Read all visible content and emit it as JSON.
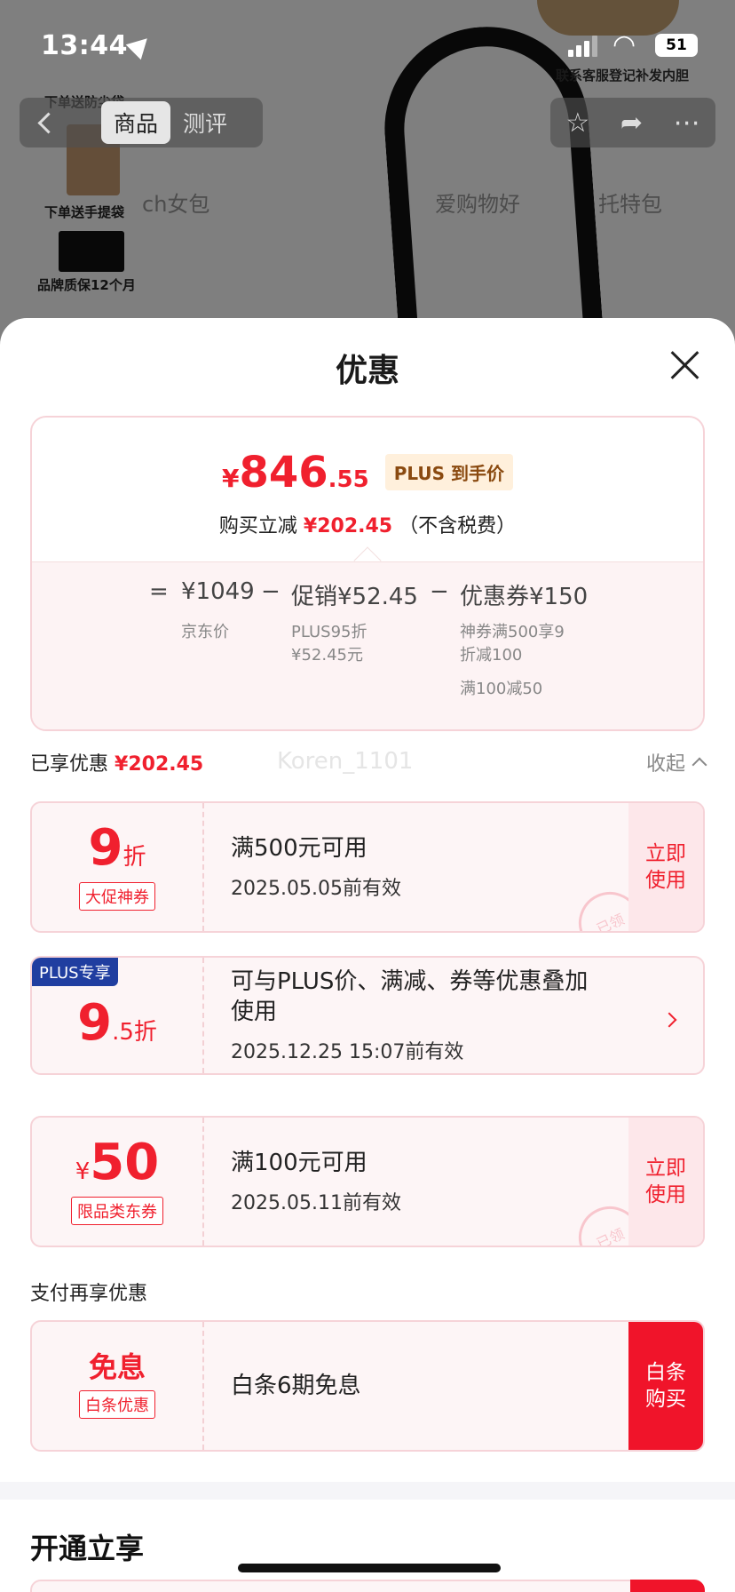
{
  "status_bar": {
    "time": "13:44",
    "battery": "51"
  },
  "background_page": {
    "nav_tabs": [
      "商品",
      "测评"
    ],
    "promo_items": [
      "下单送防尘袋",
      "下单送手提袋",
      "品牌质保12个月"
    ],
    "faded_tabs": [
      "ch女包",
      "爱购物好",
      "托特包"
    ],
    "service_note": "联系客服登记补发内胆"
  },
  "sheet": {
    "title": "优惠",
    "summary": {
      "yen": "¥",
      "price_int": "846",
      "price_dec": ".55",
      "plus_tag": "PLUS 到手价",
      "reduce_prefix": "购买立减",
      "reduce_amount": "¥202.45",
      "reduce_suffix": "（不含税费）",
      "calc": {
        "eq": "=",
        "base": "¥1049",
        "minus1": "−",
        "promo": "促销¥52.45",
        "minus2": "−",
        "coupon": "优惠券¥150",
        "base_note": "京东价",
        "promo_note_1": "PLUS95折",
        "promo_note_2": "¥52.45元",
        "coupon_note_1": "神券满500享9",
        "coupon_note_2": "折减100",
        "coupon_note_3": "满100减50"
      }
    },
    "enjoyed": {
      "label": "已享优惠",
      "amount": "¥202.45",
      "collapse": "收起",
      "watermark": "Koren_1101"
    },
    "coupons": [
      {
        "big": "9",
        "unit": "折",
        "tag": "大促神券",
        "line1": "满500元可用",
        "line2": "2025.05.05前有效",
        "action": "立即使用",
        "stamp": "已领"
      },
      {
        "badge": "PLUS专享",
        "big": "9",
        "unit": ".5折",
        "line1": "可与PLUS价、满减、券等优惠叠加使用",
        "line2": "2025.12.25 15:07前有效"
      },
      {
        "yen": "¥",
        "big": "50",
        "tag": "限品类东券",
        "line1": "满100元可用",
        "line2": "2025.05.11前有效",
        "action": "立即使用",
        "stamp": "已领"
      }
    ],
    "payment": {
      "label": "支付再享优惠",
      "big": "免息",
      "tag": "白条优惠",
      "line1": "白条6期免息",
      "action": "白条购买"
    },
    "open_title": "开通立享"
  },
  "colors": {
    "accent_red": "#f0202e",
    "plus_blue": "#203ea0",
    "plus_gold_bg": "#fff0dc"
  }
}
